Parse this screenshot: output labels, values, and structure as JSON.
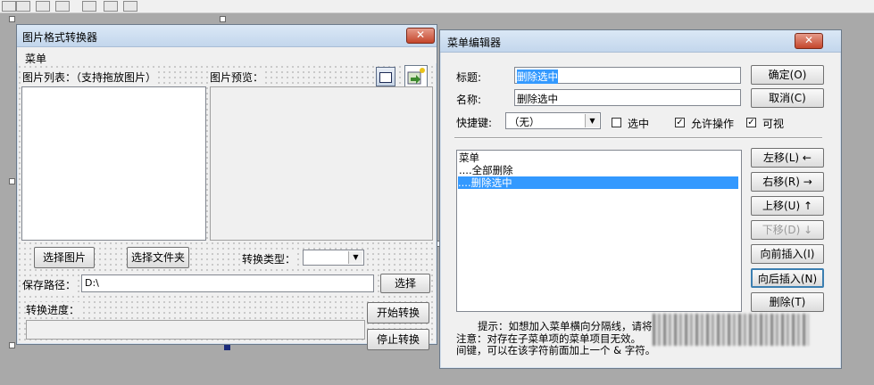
{
  "left_form": {
    "title": "图片格式转换器",
    "close_label": "✕",
    "menu_label": "菜单",
    "image_list_label": "图片列表：（支持拖放图片）",
    "image_preview_label": "图片预览：",
    "select_image_button": "选择图片",
    "select_folder_button": "选择文件夹",
    "convert_type_label": "转换类型：",
    "convert_type_value": "",
    "save_path_label": "保存路径：",
    "save_path_value": "D:\\",
    "select_path_button": "选择",
    "progress_label": "转换进度：",
    "start_button": "开始转换",
    "stop_button": "停止转换"
  },
  "menu_editor": {
    "title": "菜单编辑器",
    "close_label": "✕",
    "caption_label": "标题:",
    "caption_value": "删除选中",
    "name_label": "名称:",
    "name_value": "删除选中",
    "shortcut_label": "快捷键:",
    "shortcut_value": "（无）",
    "checked_label": "选中",
    "enabled_label": "允许操作",
    "visible_label": "可视",
    "ok_button": "确定(O)",
    "cancel_button": "取消(C)",
    "left_button": "左移(L)  ←",
    "right_button": "右移(R)  →",
    "up_button": "上移(U)  ↑",
    "down_button": "下移(D)  ↓",
    "insert_before_button": "向前插入(I)",
    "insert_after_button": "向后插入(N)",
    "delete_button": "删除(T)",
    "menu_items": [
      "菜单",
      "....全部删除",
      "....删除选中"
    ],
    "hint_line1": "提示：如想加入菜单横向分隔线，请将",
    "hint_line2": "注意：对存在子菜单项的菜单项目无效。",
    "hint_line3": "间键，可以在该字符前面加上一个 & 字符。"
  },
  "colors": {
    "selection": "#3399ff",
    "close_button": "#c4462b",
    "title_bar": "#c3d6ec",
    "canvas": "#a9a9a9"
  }
}
